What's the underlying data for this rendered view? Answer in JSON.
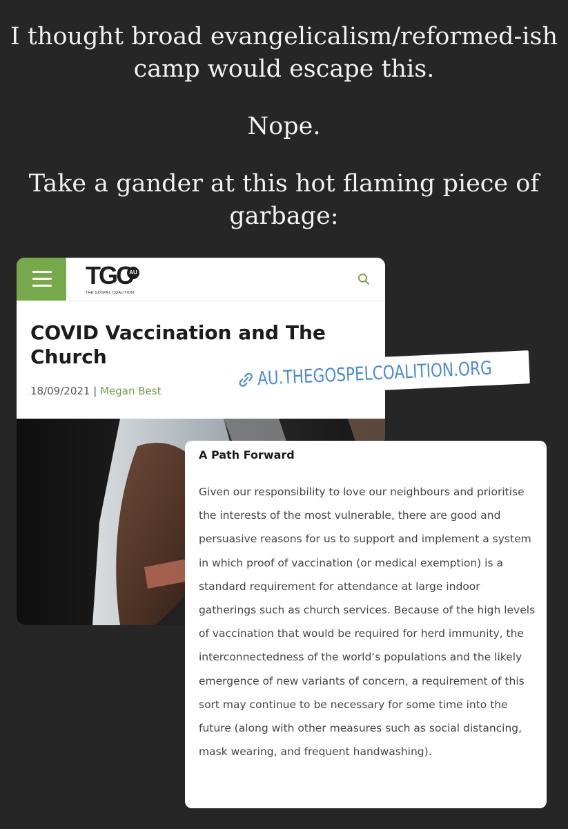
{
  "caption": {
    "line1": "I thought broad evangelicalism/reformed-ish camp would escape this.",
    "line2": "Nope.",
    "line3": "Take a gander at this hot flaming piece of garbage:"
  },
  "site": {
    "logo": "TGC",
    "region_badge": "AU",
    "tagline": "THE GOSPEL COALITION",
    "accent_color": "#76a94a",
    "menu_icon": "hamburger-icon",
    "search_icon": "search-icon"
  },
  "article": {
    "title": "COVID Vaccination and The Church",
    "date": "18/09/2021",
    "separator": "|",
    "author": "Megan Best",
    "hero_image": "arm-with-bandage-photo"
  },
  "link_sticker": {
    "icon": "link-icon",
    "url": "AU.THEGOSPELCOALITION.ORG",
    "color": "#4a8bd6"
  },
  "excerpt": {
    "heading": "A Path Forward",
    "body": "Given our responsibility to love our neighbours and prioritise the interests of the most vulnerable, there are good and persuasive reasons for us to support and implement a system in which proof of vaccination (or medical exemption) is a standard requirement for attendance at large indoor gatherings such as church services. Because of the high levels of vaccination that would be required for herd immunity, the interconnectedness of the world’s populations and the likely emergence of new variants of concern, a requirement of this sort may continue to be necessary for some time into the future (along with other measures such as social distancing, mask wearing, and frequent handwashing)."
  }
}
